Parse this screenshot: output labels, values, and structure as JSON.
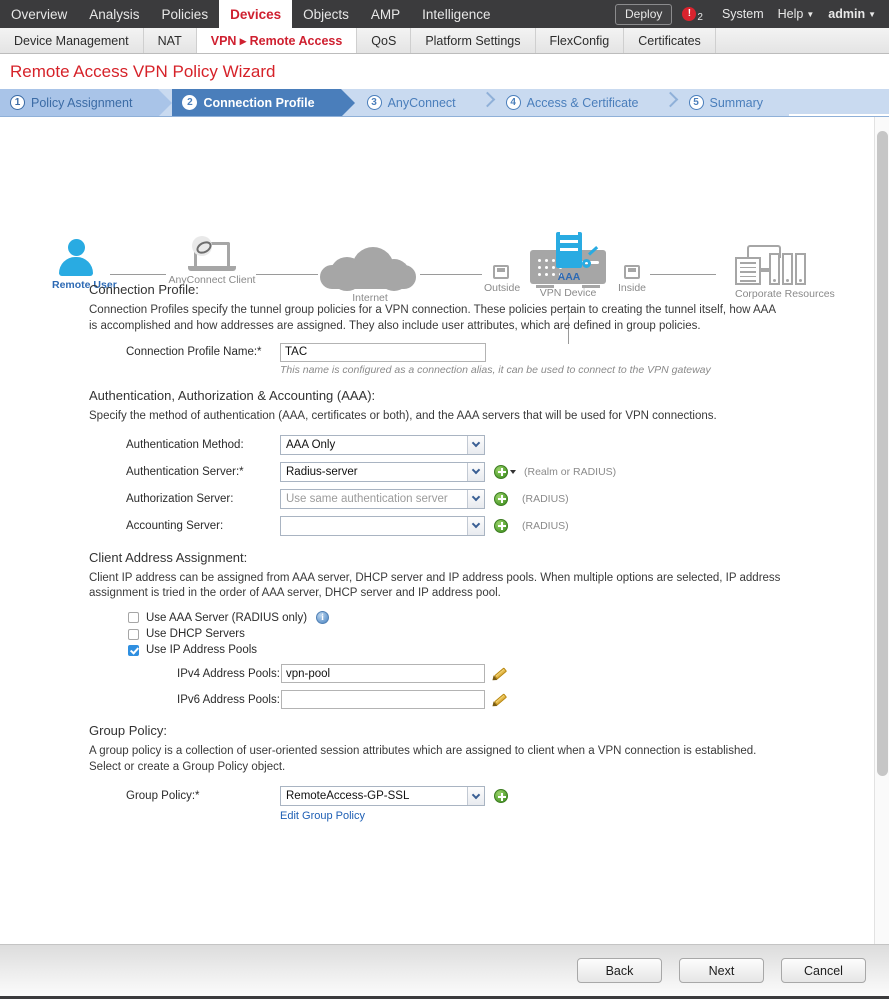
{
  "topnav": {
    "items": [
      {
        "label": "Overview",
        "active": false
      },
      {
        "label": "Analysis",
        "active": false
      },
      {
        "label": "Policies",
        "active": false
      },
      {
        "label": "Devices",
        "active": true
      },
      {
        "label": "Objects",
        "active": false
      },
      {
        "label": "AMP",
        "active": false
      },
      {
        "label": "Intelligence",
        "active": false
      }
    ],
    "deploy_label": "Deploy",
    "alert_icon": "alert-circle-icon",
    "alert_count": "2",
    "system_label": "System",
    "help_label": "Help",
    "user_label": "admin"
  },
  "subnav": {
    "items": [
      {
        "label": "Device Management",
        "active": false
      },
      {
        "label": "NAT",
        "active": false
      },
      {
        "label": "VPN ▸ Remote Access",
        "active": true
      },
      {
        "label": "QoS",
        "active": false
      },
      {
        "label": "Platform Settings",
        "active": false
      },
      {
        "label": "FlexConfig",
        "active": false
      },
      {
        "label": "Certificates",
        "active": false
      }
    ]
  },
  "page": {
    "title": "Remote Access VPN Policy Wizard"
  },
  "wizard": {
    "steps": [
      {
        "num": "1",
        "label": "Policy Assignment",
        "state": "done"
      },
      {
        "num": "2",
        "label": "Connection Profile",
        "state": "current"
      },
      {
        "num": "3",
        "label": "AnyConnect",
        "state": "todo"
      },
      {
        "num": "4",
        "label": "Access & Certificate",
        "state": "todo"
      },
      {
        "num": "5",
        "label": "Summary",
        "state": "todo"
      }
    ]
  },
  "topology": {
    "nodes": [
      {
        "label": "Remote User",
        "highlight": true
      },
      {
        "label": "AnyConnect Client",
        "highlight": false
      },
      {
        "label": "Internet",
        "highlight": false
      },
      {
        "label": "Outside",
        "highlight": false
      },
      {
        "label": "VPN Device",
        "highlight": false
      },
      {
        "label": "Inside",
        "highlight": false
      },
      {
        "label": "Corporate Resources",
        "highlight": false
      },
      {
        "label": "AAA",
        "highlight": true
      }
    ]
  },
  "connection_profile": {
    "section_title": "Connection Profile:",
    "description": "Connection Profiles specify the tunnel group policies for a VPN connection. These policies pertain to creating the tunnel itself, how AAA is accomplished and how addresses are assigned. They also include user attributes, which are defined in group policies.",
    "name_label": "Connection Profile Name:*",
    "name_value": "TAC",
    "name_hint": "This name is configured as a connection alias, it can be used to connect to the VPN gateway"
  },
  "aaa": {
    "section_title": "Authentication, Authorization & Accounting (AAA):",
    "description": "Specify the method of authentication (AAA, certificates or both), and the AAA servers that will be used for VPN connections.",
    "rows": [
      {
        "label": "Authentication Method:",
        "value": "AAA Only",
        "placeholder": false,
        "add": false,
        "add_caret": false,
        "note": ""
      },
      {
        "label": "Authentication Server:*",
        "value": "Radius-server",
        "placeholder": false,
        "add": true,
        "add_caret": true,
        "note": "(Realm or RADIUS)"
      },
      {
        "label": "Authorization Server:",
        "value": "Use same authentication server",
        "placeholder": true,
        "add": true,
        "add_caret": false,
        "note": "(RADIUS)"
      },
      {
        "label": "Accounting Server:",
        "value": "",
        "placeholder": false,
        "add": true,
        "add_caret": false,
        "note": "(RADIUS)"
      }
    ]
  },
  "client_address": {
    "section_title": "Client Address Assignment:",
    "description": "Client IP address can be assigned from AAA server, DHCP server and IP address pools. When multiple options are selected, IP address assignment is tried in the order of AAA server, DHCP server and IP address pool.",
    "checkboxes": [
      {
        "label": "Use AAA Server (RADIUS only)",
        "checked": false,
        "info": true
      },
      {
        "label": "Use DHCP Servers",
        "checked": false,
        "info": false
      },
      {
        "label": "Use IP Address Pools",
        "checked": true,
        "info": false
      }
    ],
    "ipv4_label": "IPv4 Address Pools:",
    "ipv4_value": "vpn-pool",
    "ipv6_label": "IPv6 Address Pools:",
    "ipv6_value": ""
  },
  "group_policy": {
    "section_title": "Group Policy:",
    "description": "A group policy is a collection of user-oriented session attributes which are assigned to client when a VPN connection is established. Select or create a Group Policy object.",
    "label": "Group Policy:*",
    "value": "RemoteAccess-GP-SSL",
    "edit_link": "Edit Group Policy"
  },
  "footer": {
    "back_label": "Back",
    "next_label": "Next",
    "cancel_label": "Cancel"
  }
}
